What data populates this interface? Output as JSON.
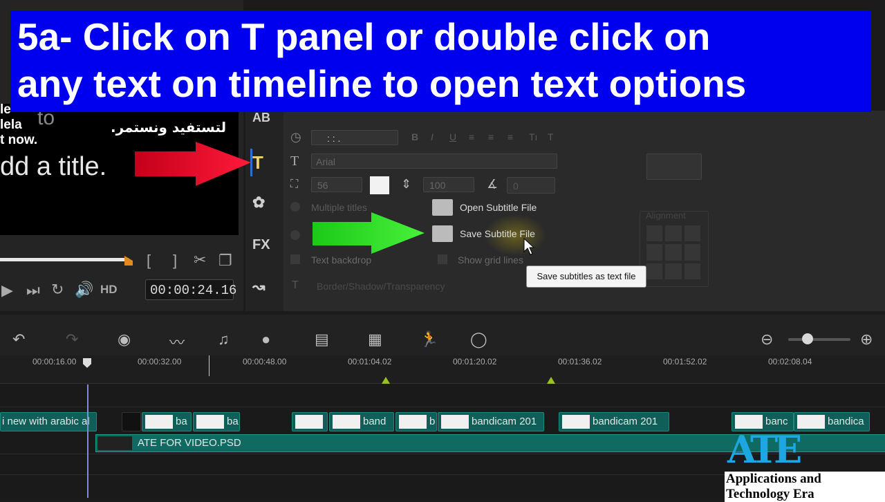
{
  "banner": {
    "line1": "5a- Click on T panel or double click on",
    "line2": "any text on timeline to open text options"
  },
  "preview": {
    "left_snip_1": "le",
    "left_snip_2": "lela",
    "left_snip_3": "t now.",
    "to_text": "to",
    "arabic_text": "لتستفيد ونستمر.",
    "add_title_text": "dd a title.",
    "hd_label": "HD",
    "timecode": "00:00:24.16"
  },
  "sidebar": {
    "ab_label": "AB",
    "t_label": "T",
    "fx_label": "FX"
  },
  "options": {
    "time_field": ":  :  .",
    "font_value": "Arial",
    "size_value": "56",
    "line_spacing_value": "100",
    "angle_value": "0",
    "multiple_titles": "Multiple titles",
    "text_backdrop": "Text backdrop",
    "show_grid_lines": "Show grid lines",
    "border_shadow": "Border/Shadow/Transparency",
    "alignment_label": "Alignment"
  },
  "menu": {
    "open_subtitle": "Open Subtitle File",
    "save_subtitle": "Save Subtitle File",
    "tooltip": "Save subtitles as text file"
  },
  "ruler": {
    "ticks": [
      "00:00:16.00",
      "00:00:32.00",
      "00:00:48.00",
      "00:01:04.02",
      "00:01:20.02",
      "00:01:36.02",
      "00:01:52.02",
      "00:02:08.04"
    ]
  },
  "clips": {
    "c1": "i new with arabic al",
    "c2": "ba",
    "c3": "ba",
    "c4": "band",
    "c5": "b",
    "c6": "bandicam 201",
    "c7": "bandicam 201",
    "c8": "banc",
    "c9": "bandica",
    "psd": "ATE FOR VIDEO.PSD"
  },
  "logo": {
    "mark": "ATE",
    "text": "Applications and Technology Era"
  },
  "colors": {
    "banner_bg": "#0000ee",
    "clip_teal": "#0f5f58",
    "arrow_red": "#e8102a",
    "arrow_green": "#22d61c"
  }
}
